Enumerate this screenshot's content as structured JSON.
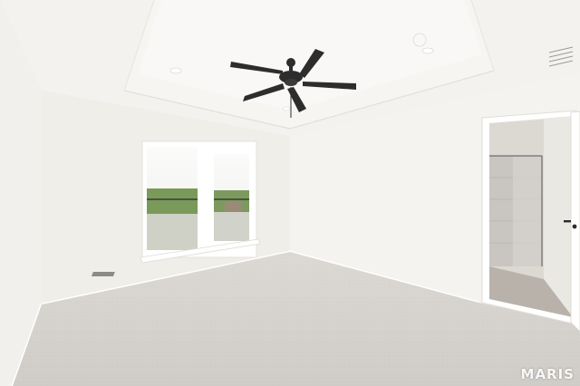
{
  "photo": {
    "subject": "empty-bedroom-interior",
    "watermark": "MARIS"
  },
  "colors": {
    "ceiling": "#f3f2ef",
    "tray": "#f7f6f3",
    "left_wall": "#f1f0ec",
    "back_wall": "#efeee9",
    "right_wall": "#f4f3ef",
    "carpet": "#d6d3ce",
    "fan": "#2d2d2d",
    "sky": "#f6f7f5",
    "trees": "#6b8a4e",
    "bathroom_floor": "#b8b2aa",
    "shower_glass": "#c9c6c1"
  }
}
